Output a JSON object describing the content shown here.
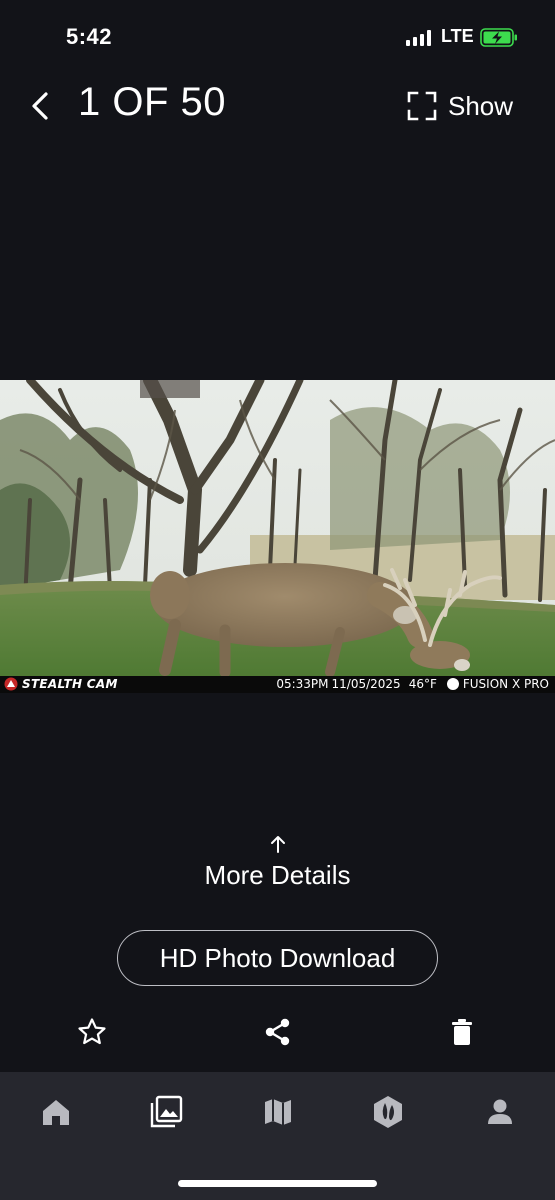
{
  "status_bar": {
    "time": "5:42",
    "network": "LTE",
    "icons": [
      "signal-icon",
      "battery-charging-icon"
    ]
  },
  "header": {
    "counter": "1 OF 50",
    "show_label": "Show",
    "icons": [
      "chevron-left-icon",
      "fullscreen-icon"
    ]
  },
  "photo": {
    "stamp_brand": "STEALTH CAM",
    "stamp_time": "05:33PM",
    "stamp_date": "11/05/2025",
    "stamp_temp": "46°F",
    "stamp_model": "FUSION X PRO"
  },
  "details": {
    "label": "More Details",
    "icon": "arrow-up-icon"
  },
  "download": {
    "label": "HD Photo Download"
  },
  "actions": {
    "icons": [
      "star-icon",
      "share-icon",
      "trash-icon"
    ]
  },
  "bottom_nav": {
    "items": [
      {
        "icon": "home-icon",
        "active": false
      },
      {
        "icon": "gallery-icon",
        "active": true
      },
      {
        "icon": "map-icon",
        "active": false
      },
      {
        "icon": "deer-track-icon",
        "active": false
      },
      {
        "icon": "profile-icon",
        "active": false
      }
    ],
    "active_color": "#ffffff",
    "inactive_color": "#b8b9bf"
  },
  "colors": {
    "background": "#121318",
    "nav_background": "#26272e",
    "battery_fill": "#3ddc4e"
  }
}
